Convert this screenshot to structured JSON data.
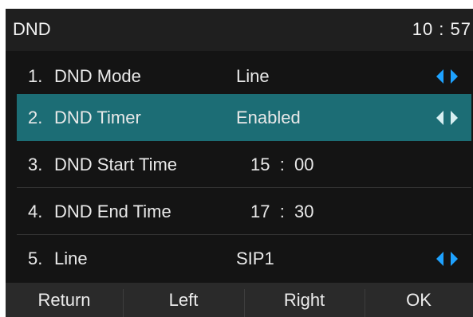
{
  "statusbar": {
    "title": "DND",
    "time": "10 : 57"
  },
  "settings": [
    {
      "number": "1.",
      "label": "DND Mode",
      "value": "Line",
      "selected": false
    },
    {
      "number": "2.",
      "label": "DND Timer",
      "value": "Enabled",
      "selected": true
    },
    {
      "number": "3.",
      "label": "DND Start Time",
      "value": "15  :  00",
      "selected": false
    },
    {
      "number": "4.",
      "label": "DND End Time",
      "value": "17  :  30",
      "selected": false
    },
    {
      "number": "5.",
      "label": "Line",
      "value": "SIP1",
      "selected": false
    }
  ],
  "softkeys": [
    "Return",
    "Left",
    "Right",
    "OK"
  ],
  "colors": {
    "background": "#141414",
    "selected_row": "#1c6d75",
    "arrow": "#1ea2ff",
    "softkey_bar": "#2a2a2a"
  },
  "icons": {
    "switch_arrows": "left-right-triangles"
  }
}
